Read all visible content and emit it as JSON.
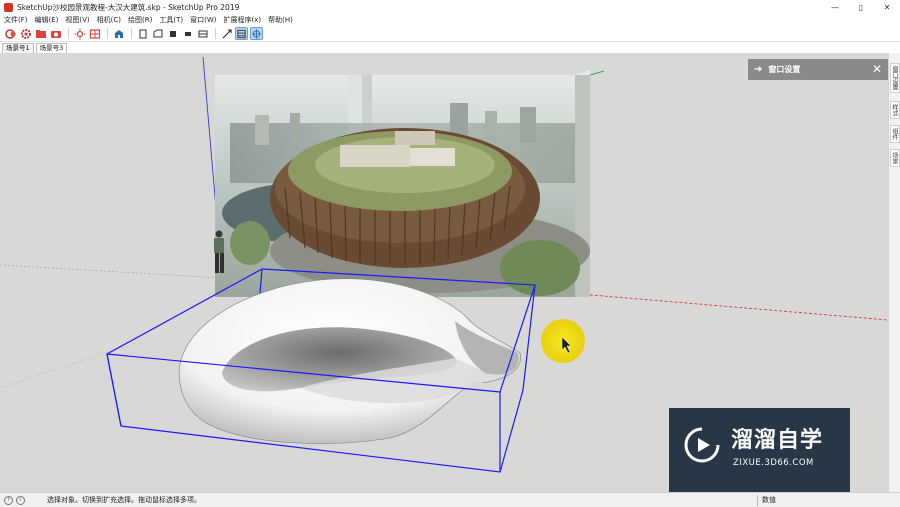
{
  "window": {
    "title": "SketchUp沙校园景观教程-大汉大建筑.skp - SketchUp Pro 2019",
    "minimize": "—",
    "maximize": "▯",
    "close": "✕"
  },
  "menu": [
    "文件(F)",
    "编辑(E)",
    "视图(V)",
    "相机(C)",
    "绘图(R)",
    "工具(T)",
    "窗口(W)",
    "扩展程序(x)",
    "帮助(H)"
  ],
  "toolbar": {
    "buttons": [
      "select-tool",
      "paint-tool",
      "eraser-tool",
      "camera-tool",
      "sun-tool",
      "component-tool",
      "warehouse-tool",
      "view-front",
      "view-back",
      "view-left",
      "view-right",
      "view-top",
      "zoom-extents",
      "section-plane",
      "axes-tool"
    ]
  },
  "scenes": [
    "场景号1",
    "场景号3"
  ],
  "tray": {
    "title": "窗口设置",
    "arrow": "➔",
    "close": "✕"
  },
  "side_tabs": [
    "窗口设置",
    "样式",
    "组件",
    "场景"
  ],
  "status": {
    "icon": "?",
    "message": "选择对象。切换到扩充选择。拖动鼠标选择多项。",
    "measure_label": "数值"
  },
  "watermark": {
    "name": "溜溜自学",
    "url": "ZIXUE.3D66.COM"
  },
  "colors": {
    "viewport_bg": "#d8d8d6",
    "selection_box": "#1a1aff",
    "axis_red": "#d23a3a",
    "axis_green": "#2aa84a",
    "axis_blue": "#3a3ad8",
    "cursor_highlight": "#f2e21a"
  }
}
